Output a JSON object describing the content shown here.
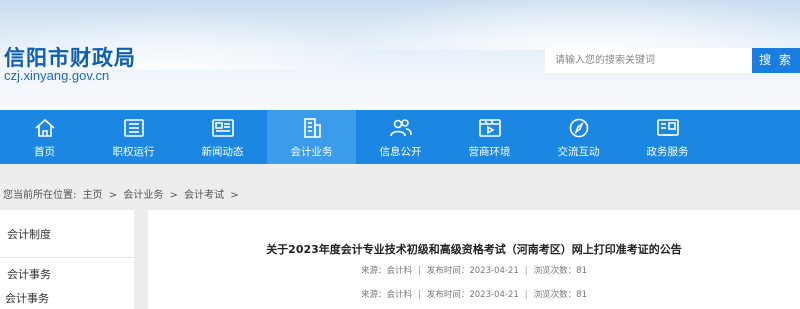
{
  "header": {
    "site_title": "信阳市财政局",
    "domain": "czj.xinyang.gov.cn",
    "search_placeholder": "请输入您的搜索关键词",
    "search_button": "搜 索"
  },
  "nav": {
    "items": [
      {
        "label": "首页",
        "icon": "home-icon"
      },
      {
        "label": "职权运行",
        "icon": "book-icon"
      },
      {
        "label": "新闻动态",
        "icon": "newspaper-icon"
      },
      {
        "label": "会计业务",
        "icon": "building-icon",
        "active": true
      },
      {
        "label": "信息公开",
        "icon": "users-icon"
      },
      {
        "label": "营商环境",
        "icon": "film-icon"
      },
      {
        "label": "交流互动",
        "icon": "compass-icon"
      },
      {
        "label": "政务服务",
        "icon": "id-card-icon"
      }
    ]
  },
  "breadcrumb": {
    "prefix": "您当前所在位置:",
    "items": [
      "主页",
      "会计业务",
      "会计考试"
    ],
    "separator": ">"
  },
  "sidebar": {
    "items": [
      "会计制度",
      "会计事务"
    ],
    "overflow_item": "会计事务"
  },
  "article": {
    "title": "关于2023年度会计专业技术初级和高级资格考试（河南考区）网上打印准考证的公告",
    "meta_rows": [
      {
        "source": "来源：会计科",
        "date": "发布时间：2023-04-21",
        "views": "浏览次数：81"
      },
      {
        "source": "来源：会计科",
        "date": "发布时间：2023-04-21",
        "views": "浏览次数：81"
      }
    ],
    "meta_separator": "|"
  },
  "colors": {
    "nav_bg": "#1b87e2",
    "nav_active": "#3c9cec",
    "title_blue": "#0f5fb0",
    "search_btn": "#1a7ee0"
  }
}
